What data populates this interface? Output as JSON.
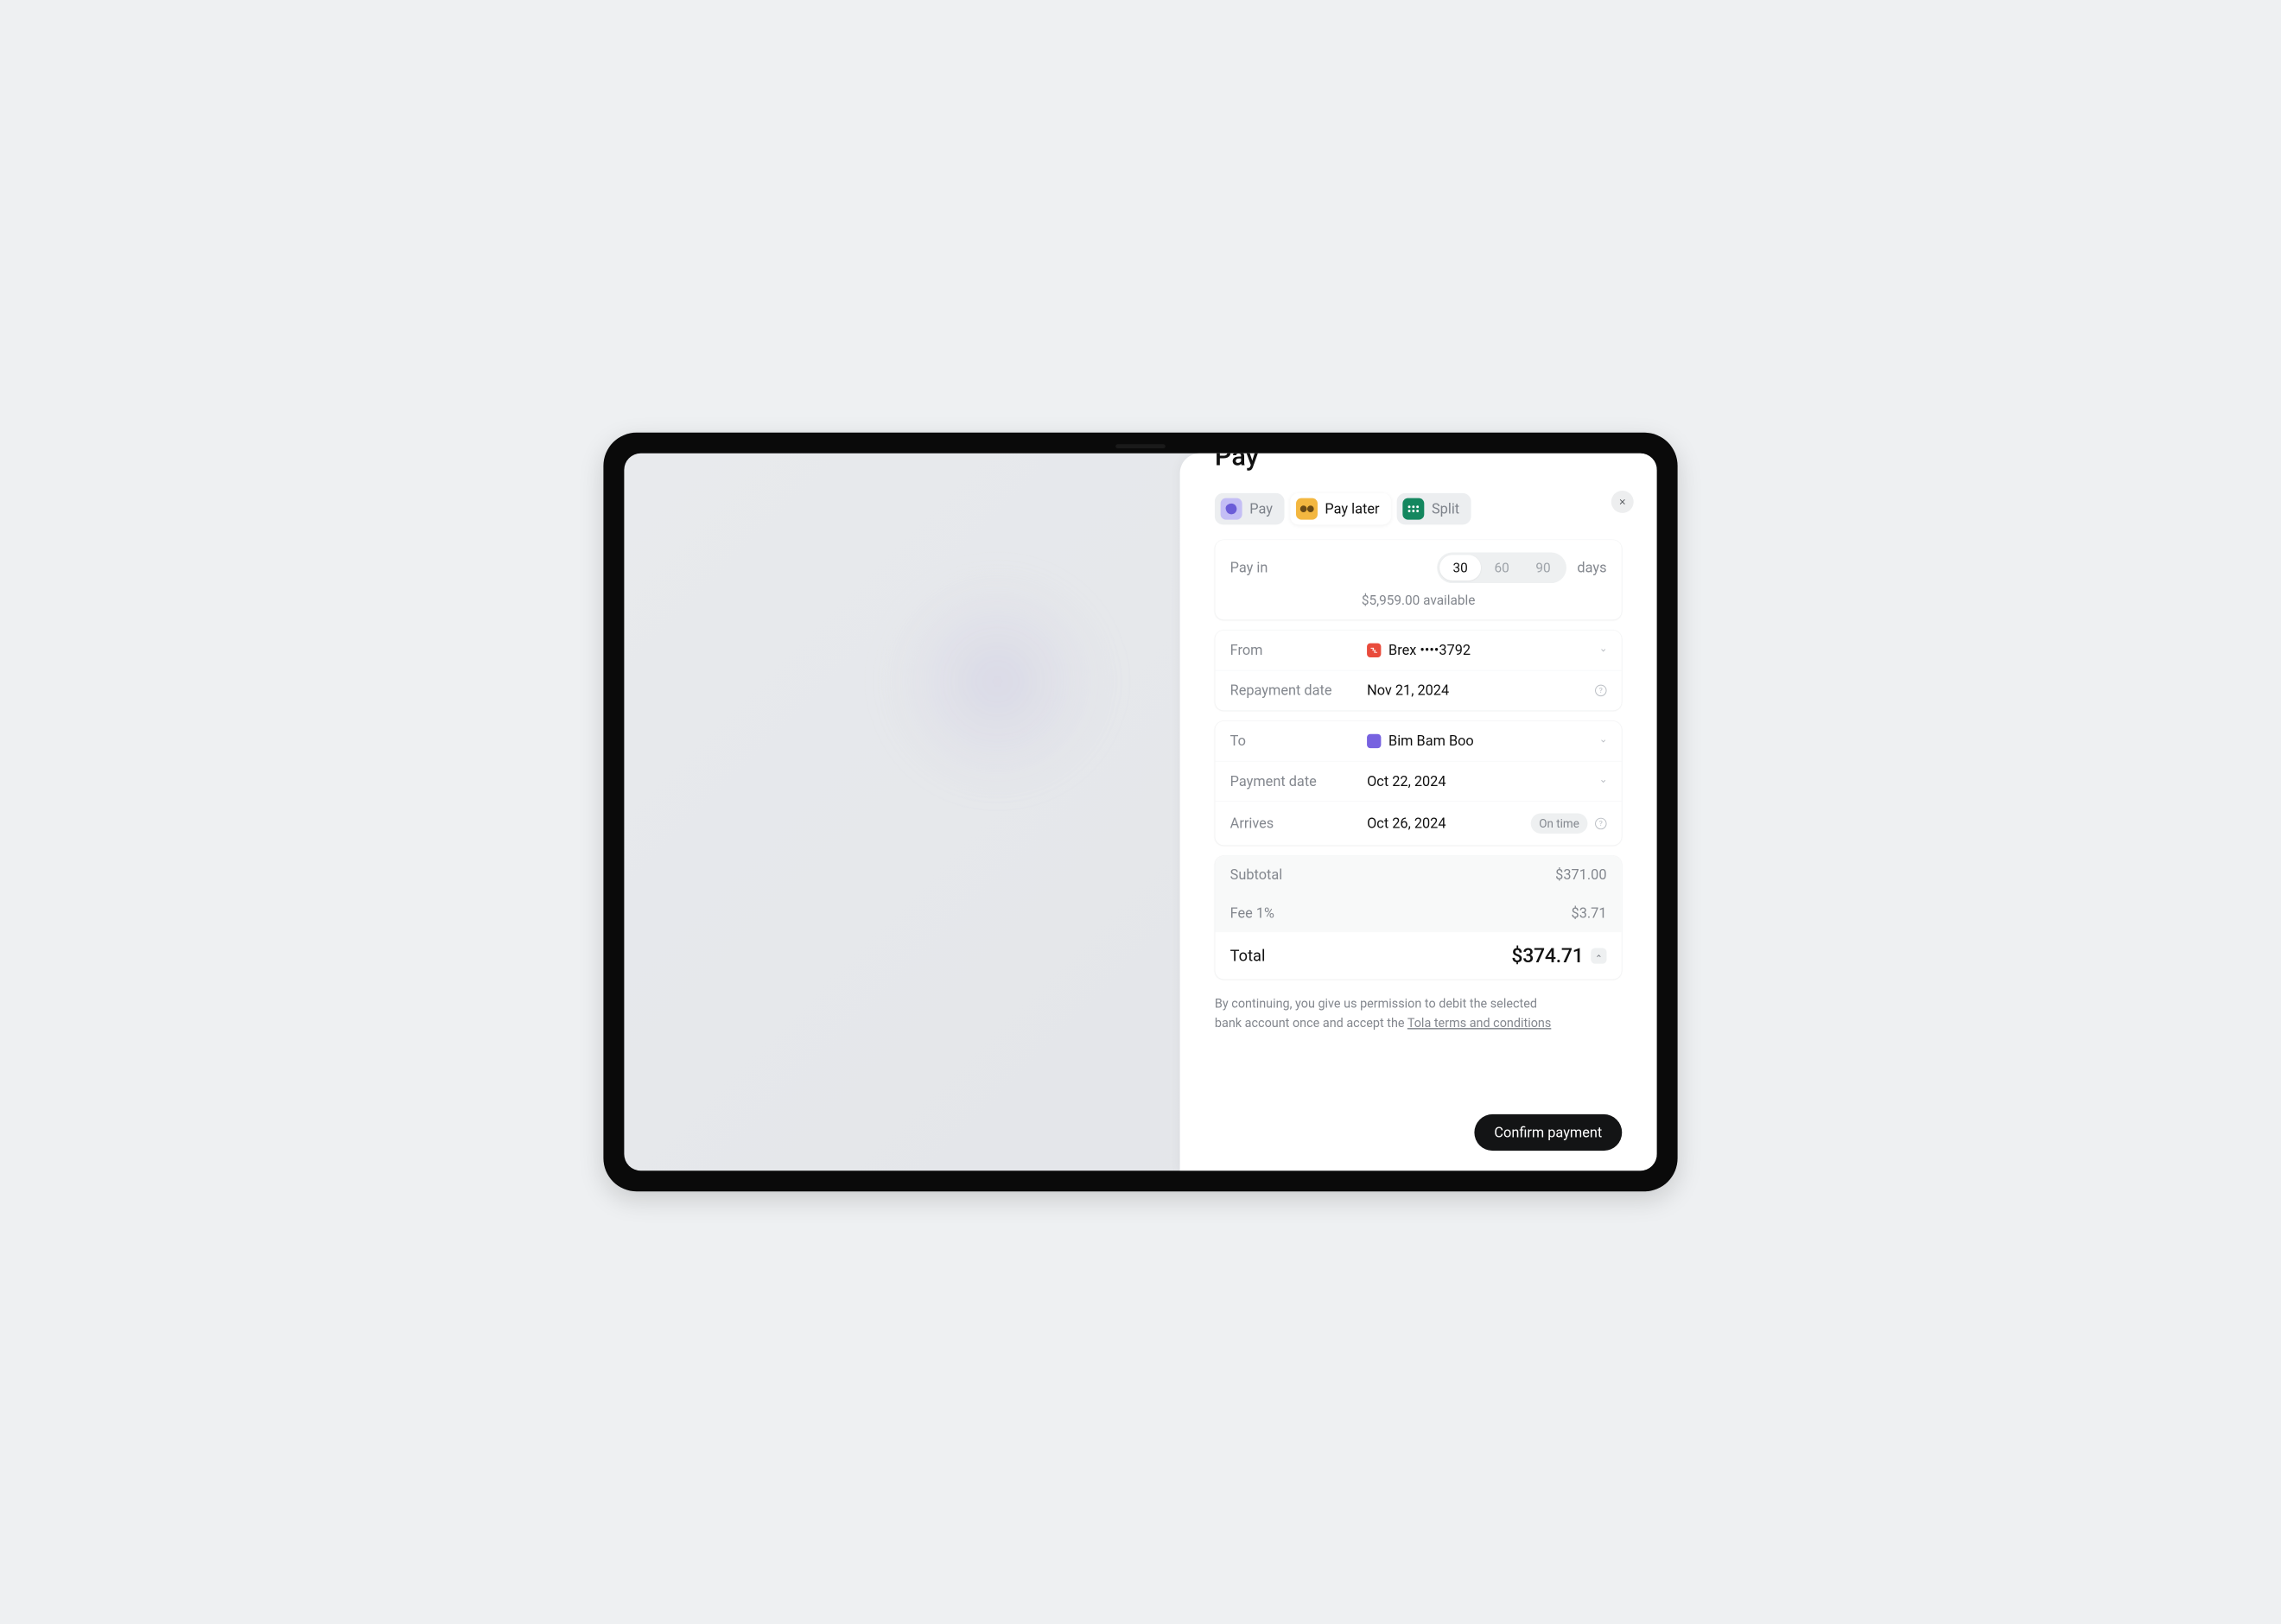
{
  "title": "Pay",
  "tabs": {
    "pay": "Pay",
    "pay_later": "Pay later",
    "split": "Split"
  },
  "pay_in": {
    "label": "Pay in",
    "options": [
      "30",
      "60",
      "90"
    ],
    "selected": "30",
    "unit": "days",
    "available": "$5,959.00 available"
  },
  "from": {
    "label": "From",
    "account": "Brex ••••3792"
  },
  "repayment": {
    "label": "Repayment date",
    "value": "Nov 21, 2024"
  },
  "to": {
    "label": "To",
    "payee": "Bim Bam Boo"
  },
  "payment_date": {
    "label": "Payment date",
    "value": "Oct 22, 2024"
  },
  "arrives": {
    "label": "Arrives",
    "value": "Oct 26, 2024",
    "status": "On time"
  },
  "summary": {
    "subtotal_label": "Subtotal",
    "subtotal_value": "$371.00",
    "fee_label": "Fee 1%",
    "fee_value": "$3.71",
    "total_label": "Total",
    "total_value": "$374.71"
  },
  "terms": {
    "text_prefix": "By continuing, you give us permission to debit the selected bank account once and accept the ",
    "link": "Tola terms and conditions"
  },
  "confirm": "Confirm payment"
}
